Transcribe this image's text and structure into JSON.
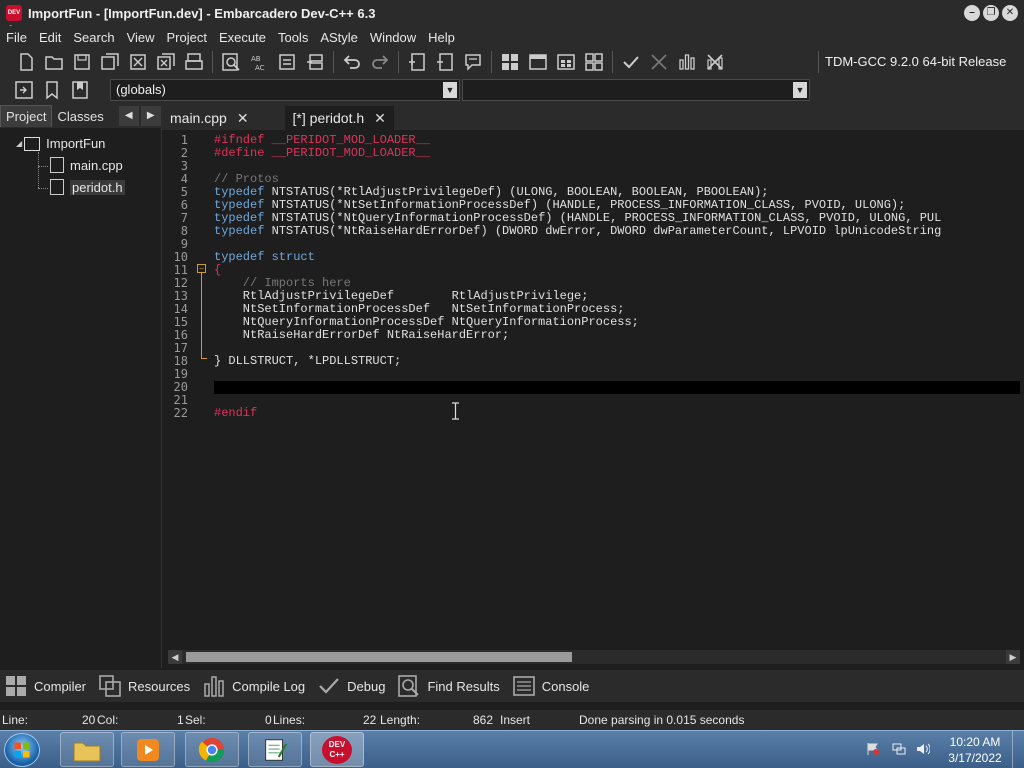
{
  "window": {
    "title": "ImportFun - [ImportFun.dev] - Embarcadero Dev-C++ 6.3",
    "app_icon_text": "DEV C++"
  },
  "menu": [
    "File",
    "Edit",
    "Search",
    "View",
    "Project",
    "Execute",
    "Tools",
    "AStyle",
    "Window",
    "Help"
  ],
  "toolbar": {
    "compiler": "TDM-GCC 9.2.0 64-bit Release",
    "scope": "(globals)"
  },
  "left_panel": {
    "tabs": [
      "Project",
      "Classes"
    ],
    "tree": {
      "project": "ImportFun",
      "files": [
        "main.cpp",
        "peridot.h"
      ]
    }
  },
  "editor_tabs": [
    {
      "label": "main.cpp"
    },
    {
      "label": "[*] peridot.h"
    }
  ],
  "editor": {
    "line_numbers": [
      "1",
      "2",
      "3",
      "4",
      "5",
      "6",
      "7",
      "8",
      "9",
      "10",
      "11",
      "12",
      "13",
      "14",
      "15",
      "16",
      "17",
      "18",
      "19",
      "20",
      "21",
      "22"
    ],
    "code": {
      "l1": "#ifndef __PERIDOT_MOD_LOADER__",
      "l2": "#define __PERIDOT_MOD_LOADER__",
      "l4": "// Protos",
      "l5_kw": "typedef",
      "l5": " NTSTATUS(*RtlAdjustPrivilegeDef) (ULONG, BOOLEAN, BOOLEAN, PBOOLEAN);",
      "l6_kw": "typedef",
      "l6": " NTSTATUS(*NtSetInformationProcessDef) (HANDLE, PROCESS_INFORMATION_CLASS, PVOID, ULONG);",
      "l7_kw": "typedef",
      "l7": " NTSTATUS(*NtQueryInformationProcessDef) (HANDLE, PROCESS_INFORMATION_CLASS, PVOID, ULONG, PUL",
      "l8_kw": "typedef",
      "l8": " NTSTATUS(*NtRaiseHardErrorDef) (DWORD dwError, DWORD dwParameterCount, LPVOID lpUnicodeString",
      "l10": "typedef struct",
      "l11": "{",
      "l12": "    // Imports here",
      "l13": "    RtlAdjustPrivilegeDef        RtlAdjustPrivilege;",
      "l14": "    NtSetInformationProcessDef   NtSetInformationProcess;",
      "l15": "    NtQueryInformationProcessDef NtQueryInformationProcess;",
      "l16": "    NtRaiseHardErrorDef NtRaiseHardError;",
      "l18": "} DLLSTRUCT, *LPDLLSTRUCT;",
      "l22": "#endif"
    }
  },
  "bottom_tabs": [
    "Compiler",
    "Resources",
    "Compile Log",
    "Debug",
    "Find Results",
    "Console"
  ],
  "status": {
    "line_label": "Line:",
    "line_value": "20",
    "col_label": "Col:",
    "col_value": "1",
    "sel_label": "Sel:",
    "sel_value": "0",
    "lines_label": "Lines:",
    "lines_value": "22",
    "length_label": "Length:",
    "length_value": "862",
    "mode": "Insert",
    "message": "Done parsing in 0.015 seconds"
  },
  "taskbar": {
    "time": "10:20 AM",
    "date": "3/17/2022",
    "devcpp_icon_text": "DEV C++"
  },
  "colors": {
    "accent_red": "#e0325a",
    "keyword_blue": "#6fa8dc",
    "fold_orange": "#d29a2a"
  }
}
